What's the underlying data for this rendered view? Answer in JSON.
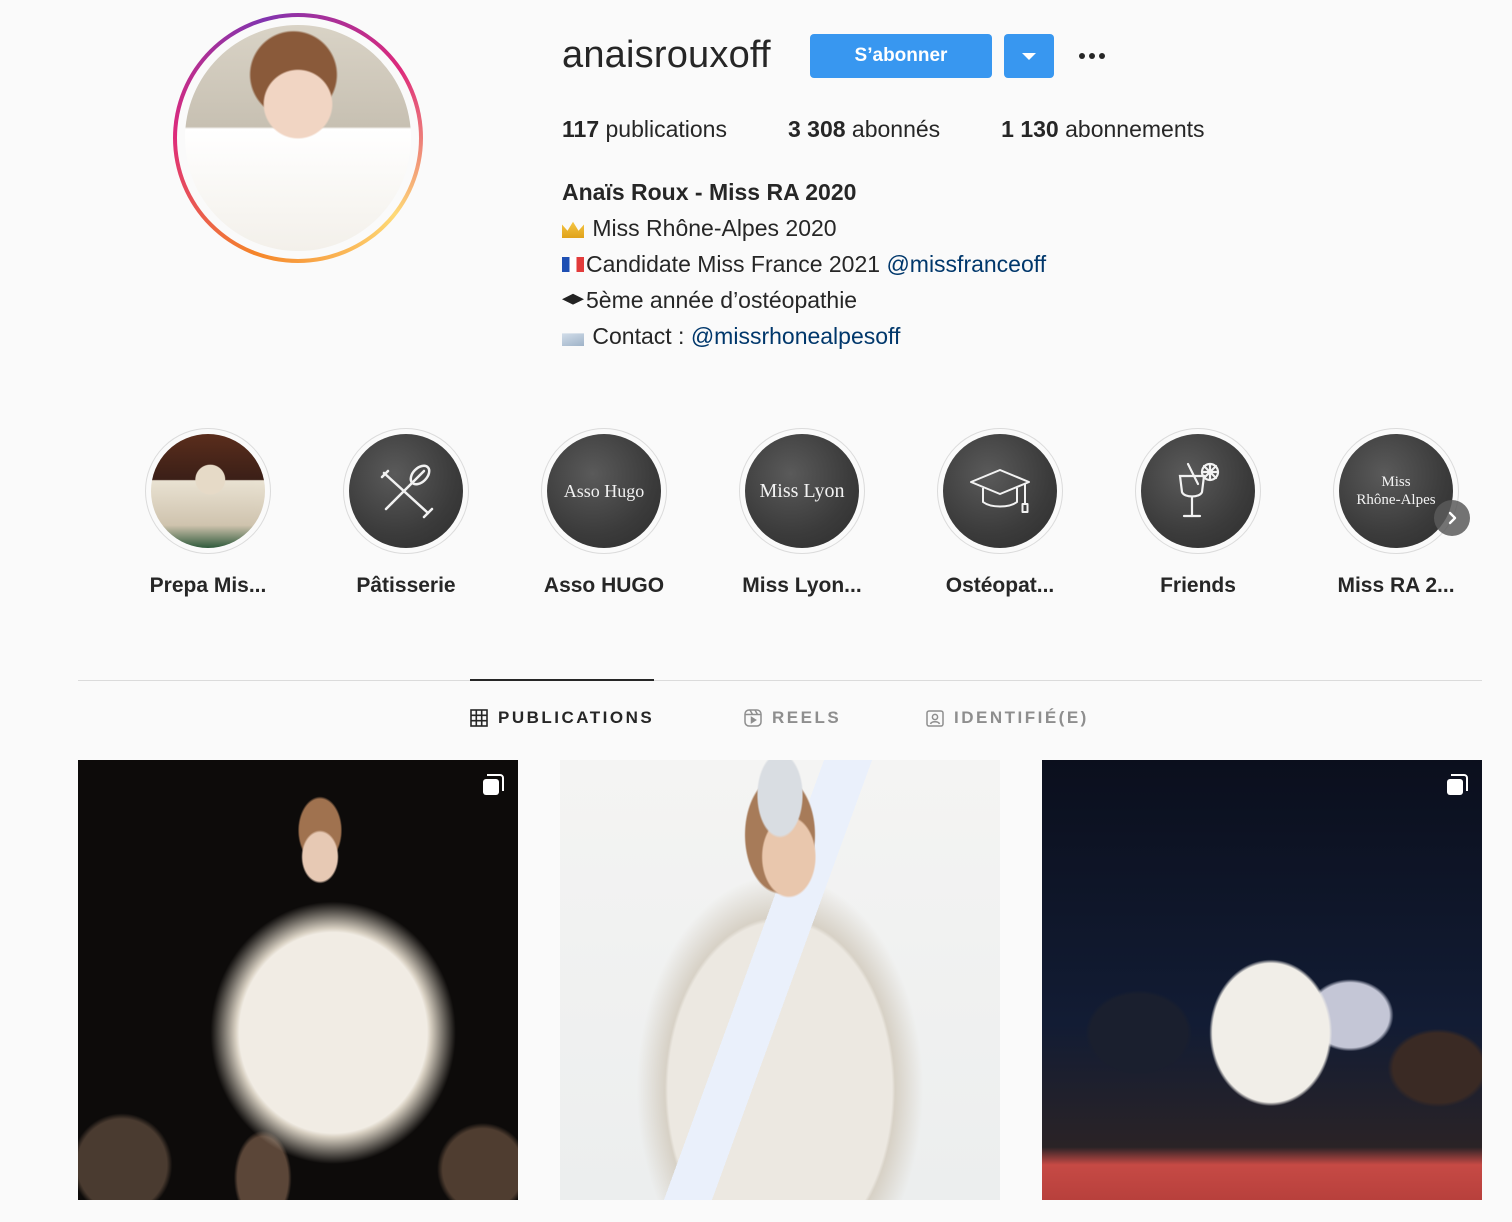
{
  "profile": {
    "username": "anaisrouxoff",
    "follow_label": "S’abonner",
    "stats": {
      "posts_count": "117",
      "posts_label": "publications",
      "followers_count": "3 308",
      "followers_label": "abonnés",
      "following_count": "1 130",
      "following_label": "abonnements"
    },
    "bio": {
      "name": "Anaïs Roux - Miss RA 2020",
      "line1": "Miss Rhône-Alpes 2020",
      "line2_text": "Candidate Miss France 2021 ",
      "line2_mention": "@missfranceoff",
      "line3": "5ème année d’ostéopathie",
      "line4_text": "Contact : ",
      "line4_mention": "@missrhonealpesoff"
    },
    "colors": {
      "accent": "#3897f0",
      "mention": "#00376b",
      "text": "#262626",
      "muted": "#8e8e8e",
      "background": "#fafafa"
    }
  },
  "highlights": [
    {
      "label": "Prepa Mis...",
      "cover_text": "",
      "icon": "photo-cover"
    },
    {
      "label": "Pâtisserie",
      "cover_text": "",
      "icon": "whisk-rolling-pin-icon"
    },
    {
      "label": "Asso HUGO",
      "cover_text": "Asso Hugo",
      "icon": ""
    },
    {
      "label": "Miss Lyon...",
      "cover_text": "Miss Lyon",
      "icon": ""
    },
    {
      "label": "Ostéopat...",
      "cover_text": "",
      "icon": "graduation-cap-icon"
    },
    {
      "label": "Friends",
      "cover_text": "",
      "icon": "cocktail-icon"
    },
    {
      "label": "Miss RA 2...",
      "cover_text_line1": "Miss",
      "cover_text_line2": "Rhône-Alpes",
      "icon": ""
    }
  ],
  "tabs": [
    {
      "label": "PUBLICATIONS",
      "icon": "grid-icon",
      "active": true
    },
    {
      "label": "REELS",
      "icon": "reels-icon",
      "active": false
    },
    {
      "label": "IDENTIFIÉ(E)",
      "icon": "tagged-icon",
      "active": false
    }
  ],
  "posts": [
    {
      "type": "carousel",
      "icon": "multiple-posts-icon"
    },
    {
      "type": "single",
      "icon": ""
    },
    {
      "type": "carousel",
      "icon": "multiple-posts-icon"
    }
  ]
}
